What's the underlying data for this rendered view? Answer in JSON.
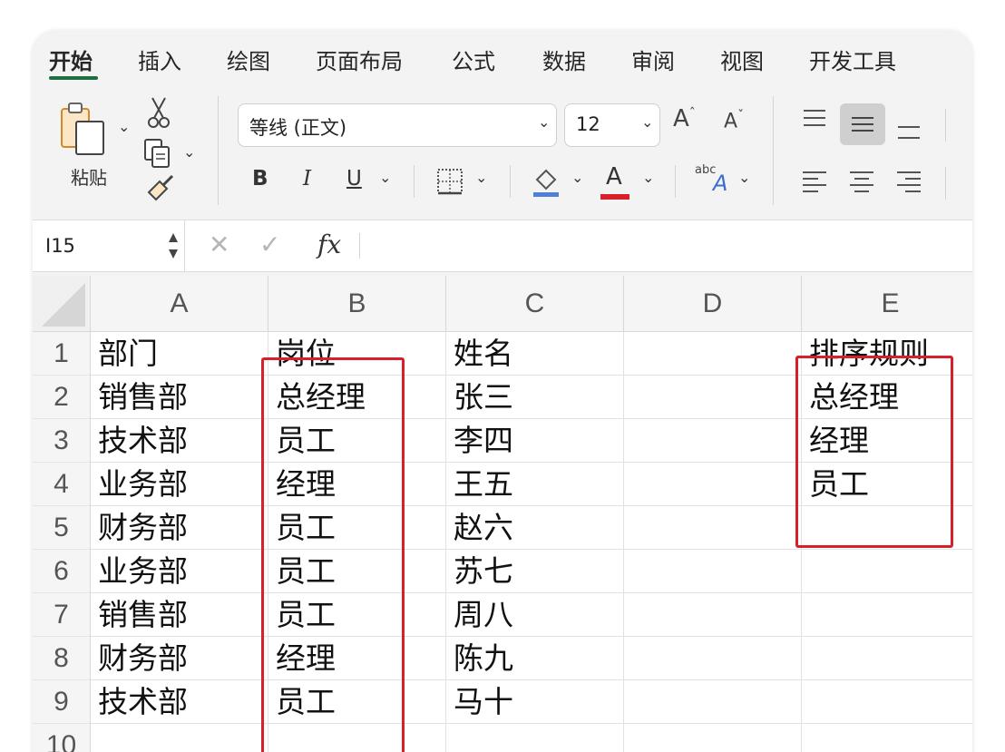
{
  "menu": {
    "tabs": [
      "开始",
      "插入",
      "绘图",
      "页面布局",
      "公式",
      "数据",
      "审阅",
      "视图",
      "开发工具"
    ],
    "active_tab": "开始"
  },
  "ribbon": {
    "paste_label": "粘贴",
    "font_name": "等线 (正文)",
    "font_size": "12",
    "bold": "B",
    "italic": "I",
    "underline": "U",
    "font_color_letter": "A",
    "grow_font": "A",
    "shrink_font": "A",
    "text_direction_small": "abc",
    "text_direction_big": "A",
    "accent_color": "#1f6e43",
    "font_color": "#d8202b"
  },
  "formula_bar": {
    "name_box": "I15",
    "cancel": "✕",
    "enter": "✓",
    "fx": "fx",
    "formula": ""
  },
  "sheet": {
    "columns": [
      "A",
      "B",
      "C",
      "D",
      "E"
    ],
    "rows": [
      "1",
      "2",
      "3",
      "4",
      "5",
      "6",
      "7",
      "8",
      "9",
      "10"
    ],
    "cells": [
      [
        "部门",
        "岗位",
        "姓名",
        "",
        "排序规则"
      ],
      [
        "销售部",
        "总经理",
        "张三",
        "",
        "总经理"
      ],
      [
        "技术部",
        "员工",
        "李四",
        "",
        "经理"
      ],
      [
        "业务部",
        "经理",
        "王五",
        "",
        "员工"
      ],
      [
        "财务部",
        "员工",
        "赵六",
        "",
        ""
      ],
      [
        "业务部",
        "员工",
        "苏七",
        "",
        ""
      ],
      [
        "销售部",
        "员工",
        "周八",
        "",
        ""
      ],
      [
        "财务部",
        "经理",
        "陈九",
        "",
        ""
      ],
      [
        "技术部",
        "员工",
        "马十",
        "",
        ""
      ],
      [
        "",
        "",
        "",
        "",
        ""
      ]
    ],
    "highlight_color": "#d8202b"
  }
}
